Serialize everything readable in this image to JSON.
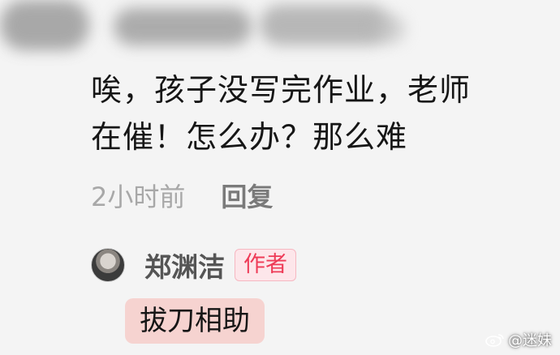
{
  "comment": {
    "text_line1": "唉，孩子没写完作业，老师",
    "text_line2": "在催！怎么办？那么难",
    "time": "2小时前",
    "reply_label": "回复"
  },
  "author_reply": {
    "name": "郑渊洁",
    "badge": "作者",
    "text": "拔刀相助"
  },
  "watermark": {
    "text": "@迷妹",
    "icon": "weibo-icon"
  },
  "colors": {
    "badge_text": "#ee3b57",
    "badge_bg": "#fde6ea",
    "highlight_bg": "#f6d3d0"
  }
}
